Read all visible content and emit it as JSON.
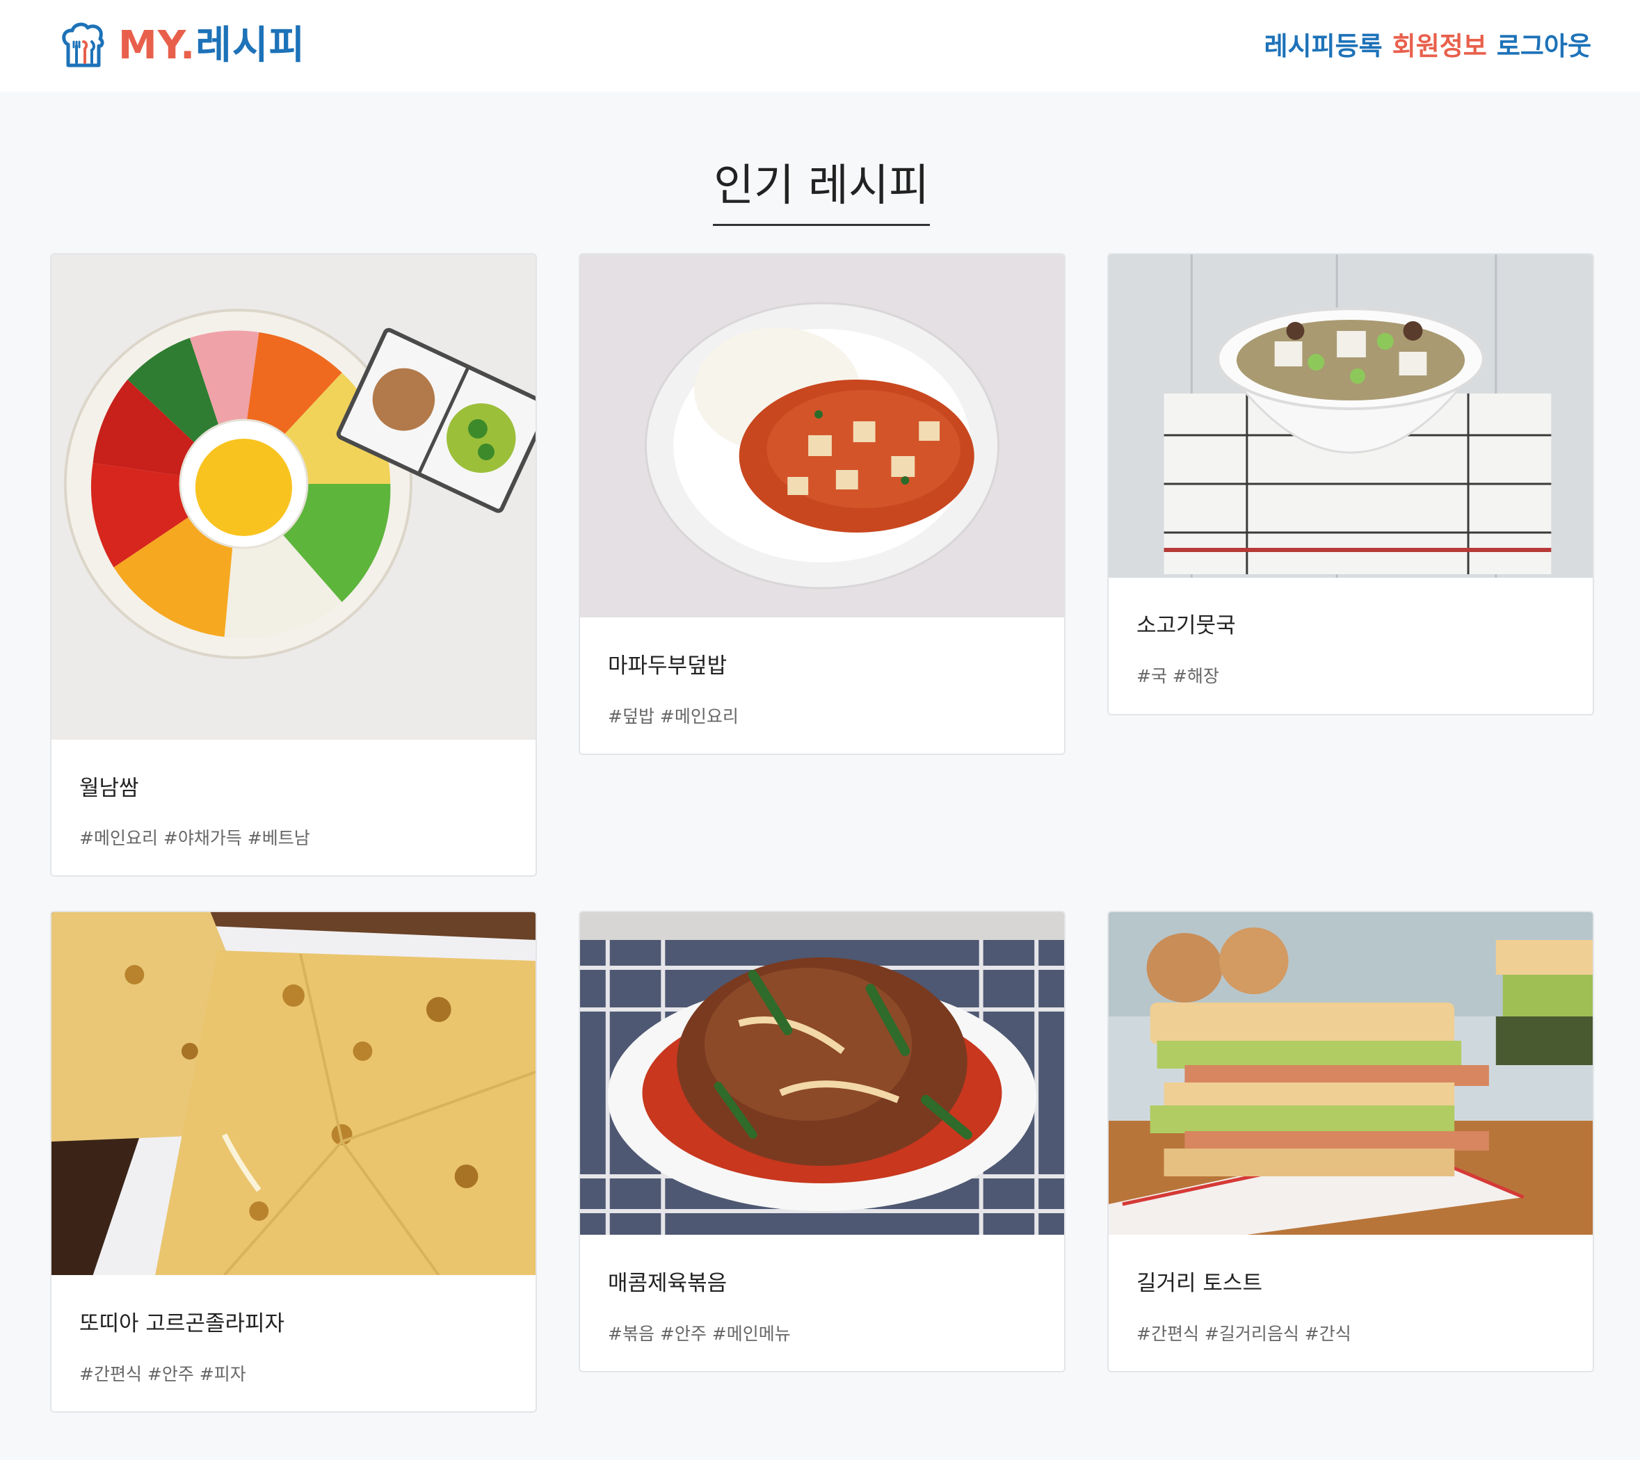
{
  "header": {
    "logo": {
      "my": "MY",
      "dot": ".",
      "recipe": "레시피"
    },
    "nav": {
      "register": "레시피등록",
      "profile": "회원정보",
      "logout": "로그아웃"
    }
  },
  "main": {
    "title": "인기 레시피",
    "recipes": [
      {
        "name": "월남쌈",
        "tags": "#메인요리 #야채가득 #베트남",
        "image": "spring-roll-platter-photo"
      },
      {
        "name": "마파두부덮밥",
        "tags": "#덮밥 #메인요리",
        "image": "mapo-tofu-rice-photo"
      },
      {
        "name": "소고기뭇국",
        "tags": "#국 #해장",
        "image": "beef-radish-soup-photo"
      },
      {
        "name": "또띠아 고르곤졸라피자",
        "tags": "#간편식 #안주 #피자",
        "image": "gorgonzola-pizza-photo"
      },
      {
        "name": "매콤제육볶음",
        "tags": "#볶음 #안주 #메인메뉴",
        "image": "spicy-pork-stir-fry-photo"
      },
      {
        "name": "길거리 토스트",
        "tags": "#간편식 #길거리음식 #간식",
        "image": "street-toast-photo"
      }
    ]
  },
  "colors": {
    "brand_blue": "#1d72b8",
    "brand_red": "#e8604c",
    "page_background": "#f7f8fa"
  }
}
